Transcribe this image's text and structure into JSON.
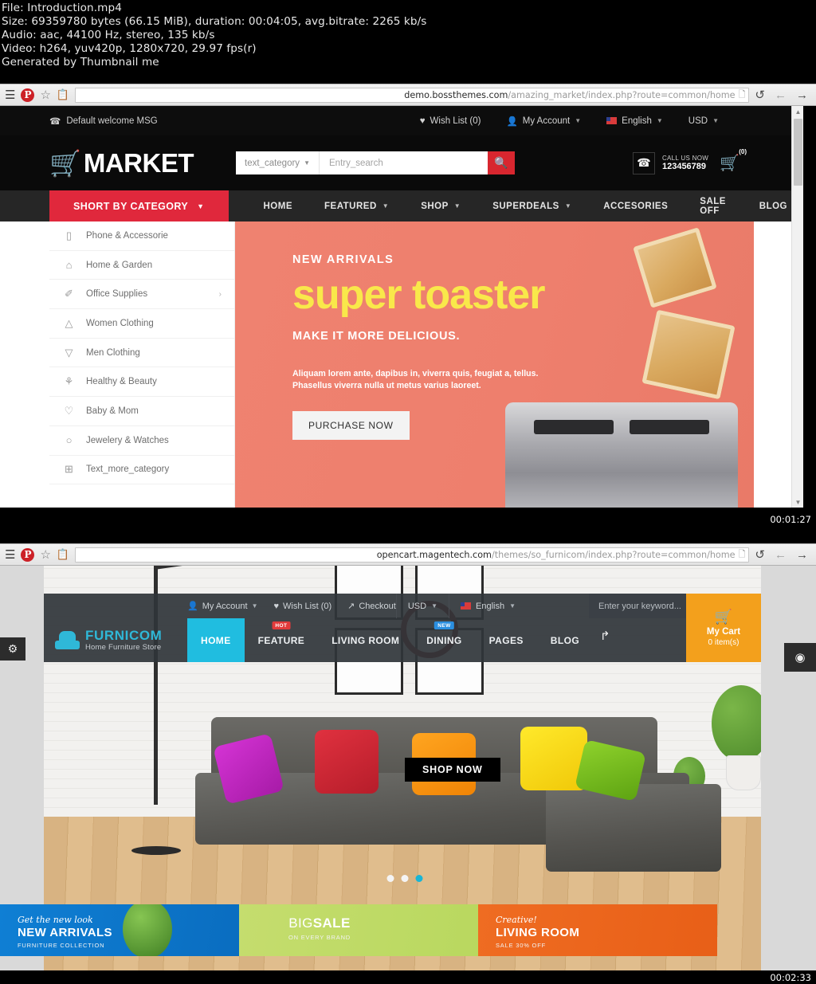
{
  "video_meta": {
    "file_line": "File: Introduction.mp4",
    "size_line": "Size: 69359780 bytes (66.15 MiB), duration: 00:04:05, avg.bitrate: 2265 kb/s",
    "audio_line": "Audio: aac, 44100 Hz, stereo, 135 kb/s",
    "video_line": "Video: h264, yuv420p, 1280x720, 29.97 fps(r)",
    "generator_line": "Generated by Thumbnail me"
  },
  "thumbnails": [
    {
      "timestamp": "00:01:27"
    },
    {
      "timestamp": "00:02:33"
    }
  ],
  "shot1": {
    "browser": {
      "menu_icon": "hamburger-icon",
      "pin_label": "P",
      "star_icon": "star-icon",
      "clipboard_icon": "clipboard-icon",
      "url_domain": "demo.bossthemes.com",
      "url_path": "/amazing_market/index.php?route=common/home",
      "page_icon": "page-icon",
      "reload_icon": "↺",
      "back_icon": "←",
      "forward_icon": "→"
    },
    "topbar": {
      "welcome": "Default welcome MSG",
      "phone_icon": "phone-icon",
      "wishlist": "Wish List (0)",
      "account": "My Account",
      "language": "English",
      "currency": "USD"
    },
    "header": {
      "logo_text": "MARKET",
      "search_category": "text_category",
      "search_placeholder": "Entry_search",
      "call_label": "CALL US NOW",
      "call_number": "123456789",
      "cart_count": "(0)"
    },
    "nav": {
      "category_button": "SHORT BY CATEGORY",
      "items": [
        {
          "label": "HOME",
          "caret": false
        },
        {
          "label": "FEATURED",
          "caret": true
        },
        {
          "label": "SHOP",
          "caret": true
        },
        {
          "label": "SUPERDEALS",
          "caret": true
        },
        {
          "label": "ACCESORIES",
          "caret": false
        },
        {
          "label": "SALE OFF",
          "caret": false
        },
        {
          "label": "BLOG",
          "caret": false
        }
      ]
    },
    "categories": [
      {
        "label": "Phone & Accessorie",
        "icon": "phone-icon",
        "glyph": "▯",
        "arrow": false
      },
      {
        "label": "Home & Garden",
        "icon": "home-icon",
        "glyph": "⌂",
        "arrow": false
      },
      {
        "label": "Office Supplies",
        "icon": "paperclip-icon",
        "glyph": "✐",
        "arrow": true
      },
      {
        "label": "Women Clothing",
        "icon": "dress-icon",
        "glyph": "△",
        "arrow": false
      },
      {
        "label": "Men Clothing",
        "icon": "shirt-icon",
        "glyph": "▽",
        "arrow": false
      },
      {
        "label": "Healthy & Beauty",
        "icon": "beauty-icon",
        "glyph": "⚘",
        "arrow": false
      },
      {
        "label": "Baby & Mom",
        "icon": "baby-icon",
        "glyph": "♡",
        "arrow": false
      },
      {
        "label": "Jewelery & Watches",
        "icon": "ring-icon",
        "glyph": "○",
        "arrow": false
      },
      {
        "label": "Text_more_category",
        "icon": "plus-box-icon",
        "glyph": "⊞",
        "arrow": false
      }
    ],
    "banner": {
      "kicker": "NEW ARRIVALS",
      "title": "super toaster",
      "subtitle": "MAKE IT MORE DELICIOUS.",
      "description_line1": "Aliquam lorem ante, dapibus in, viverra quis, feugiat a, tellus.",
      "description_line2": "Phasellus viverra nulla ut metus varius laoreet.",
      "cta": "PURCHASE NOW",
      "bg_color": "#ee7f6d",
      "title_color": "#f9e84a"
    }
  },
  "shot2": {
    "browser": {
      "menu_icon": "hamburger-icon",
      "pin_label": "P",
      "star_icon": "star-icon",
      "clipboard_icon": "clipboard-icon",
      "url_domain": "opencart.magentech.com",
      "url_path": "/themes/so_furnicom/index.php?route=common/home",
      "page_icon": "page-icon",
      "reload_icon": "↺",
      "back_icon": "←",
      "forward_icon": "→"
    },
    "topbar": {
      "account": "My Account",
      "wishlist": "Wish List (0)",
      "checkout": "Checkout",
      "currency": "USD",
      "language": "English",
      "search_placeholder": "Enter your keyword...",
      "search_icon": "search-icon"
    },
    "brand": {
      "name": "FURNICOM",
      "tagline": "Home Furniture Store",
      "icon": "armchair-icon",
      "accent": "#2fb8d8"
    },
    "menu": [
      {
        "label": "HOME",
        "tag": "",
        "active": true
      },
      {
        "label": "FEATURE",
        "tag": "HOT",
        "active": false
      },
      {
        "label": "LIVING ROOM",
        "tag": "",
        "active": false
      },
      {
        "label": "DINING",
        "tag": "NEW",
        "active": false
      },
      {
        "label": "PAGES",
        "tag": "",
        "active": false
      },
      {
        "label": "BLOG",
        "tag": "",
        "active": false
      }
    ],
    "cart": {
      "icon": "cart-icon",
      "title": "My Cart",
      "items": "0 item(s)",
      "bg": "#f3a01c"
    },
    "hero": {
      "cta": "SHOP NOW",
      "slide_count": 3,
      "active_slide": 3,
      "active_dot_color": "#19b5d5"
    },
    "promos": [
      {
        "script": "Get the new look",
        "main": "NEW ARRIVALS",
        "sub": "FURNITURE COLLECTION",
        "bg": "#0a6dc0"
      },
      {
        "script": "",
        "main_light": "BIG",
        "main": "SALE",
        "sub": "ON EVERY BRAND",
        "bg": "#bbd962"
      },
      {
        "script": "Creative!",
        "main": "LIVING ROOM",
        "sub": "SALE 30% OFF",
        "bg": "#ec6620"
      }
    ],
    "widgets": [
      {
        "name": "settings-widget",
        "glyph": "⚙"
      },
      {
        "name": "preview-widget",
        "glyph": "◉"
      }
    ],
    "cursor_glyph": "↱"
  }
}
